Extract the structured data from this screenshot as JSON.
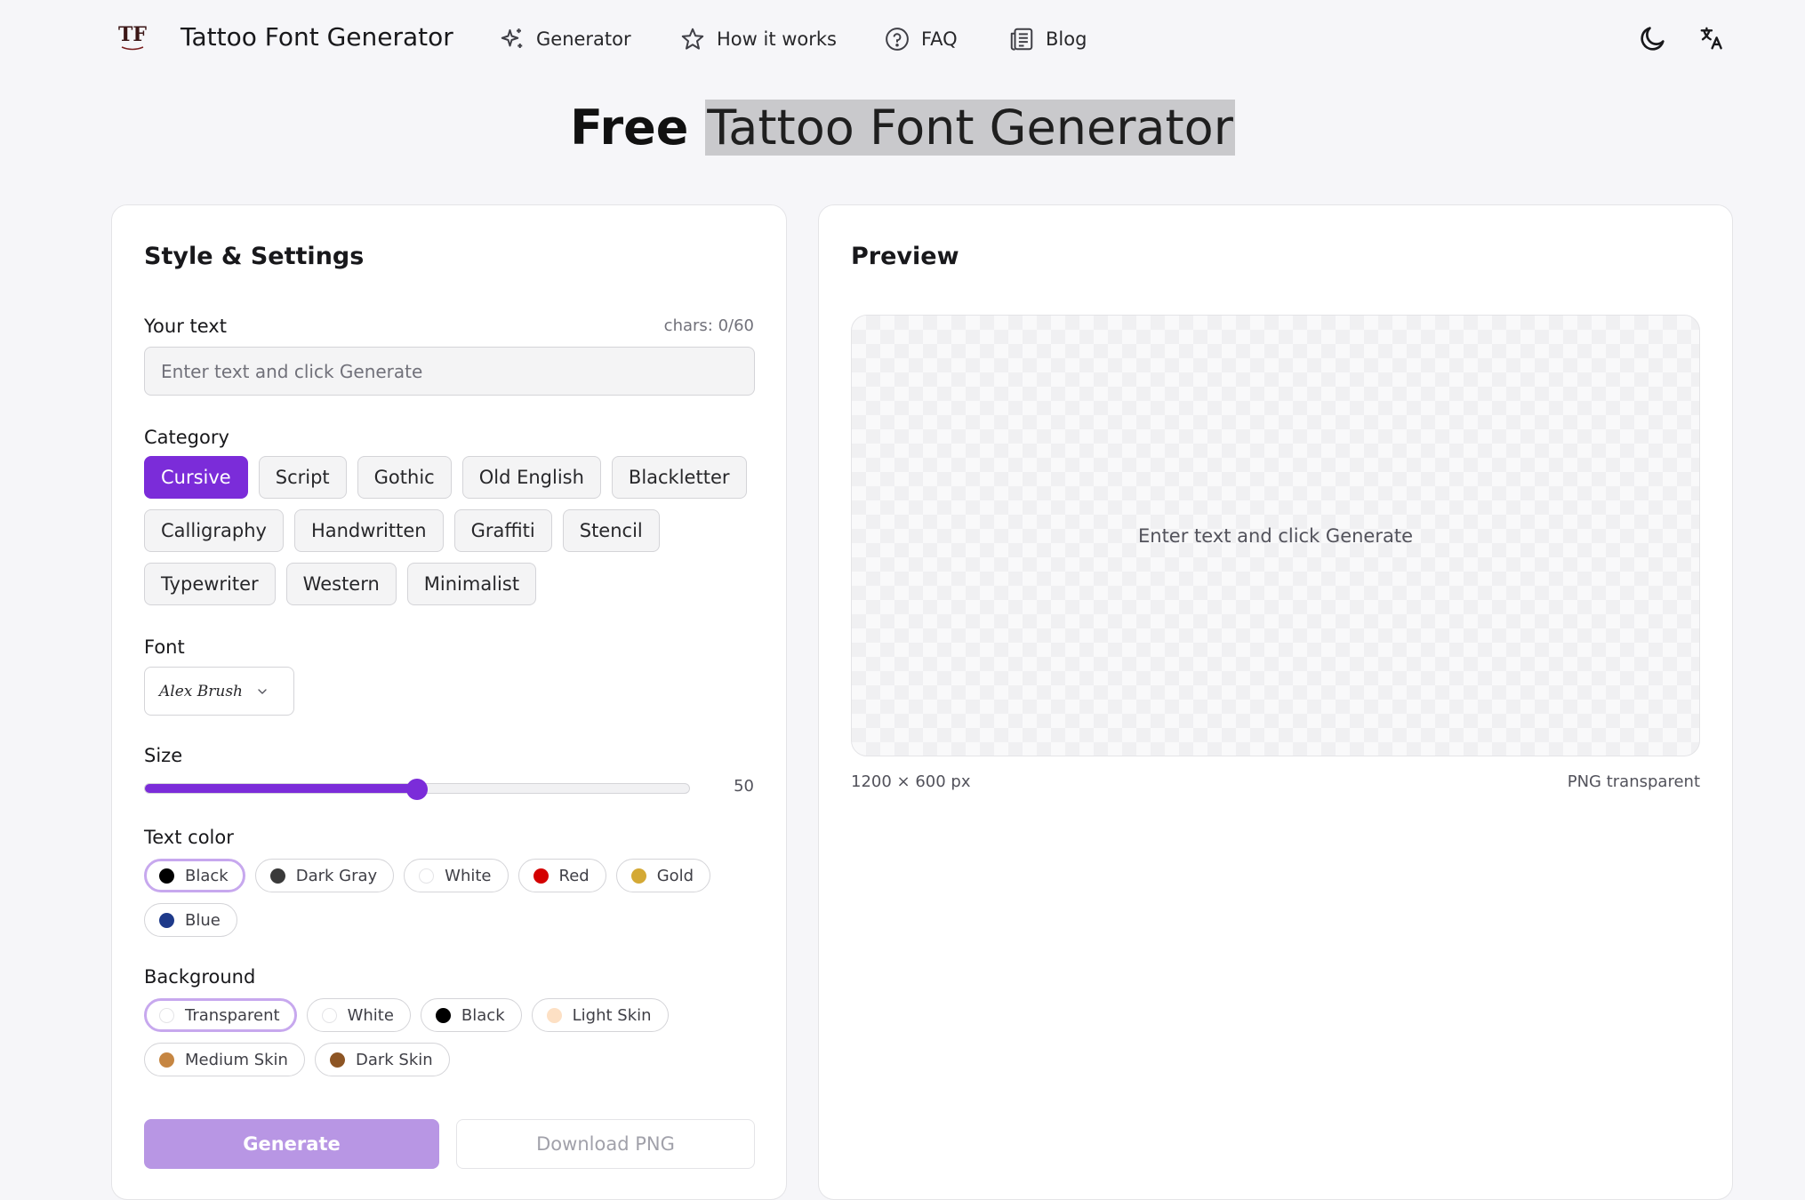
{
  "header": {
    "brand": "Tattoo Font Generator",
    "logo_text": "TF",
    "nav": [
      {
        "label": "Generator",
        "icon": "sparkles-icon"
      },
      {
        "label": "How it works",
        "icon": "star-outline-icon"
      },
      {
        "label": "FAQ",
        "icon": "help-circle-icon"
      },
      {
        "label": "Blog",
        "icon": "newspaper-icon"
      }
    ],
    "right_icons": [
      "moon-icon",
      "translate-icon"
    ]
  },
  "title": {
    "prefix": "Free",
    "highlight": "Tattoo Font Generator"
  },
  "settings": {
    "heading": "Style & Settings",
    "text_label": "Your text",
    "chars_counter": "chars: 0/60",
    "text_value": "",
    "text_placeholder": "Enter text and click Generate",
    "category_label": "Category",
    "categories": [
      "Cursive",
      "Script",
      "Gothic",
      "Old English",
      "Blackletter",
      "Calligraphy",
      "Handwritten",
      "Graffiti",
      "Stencil",
      "Typewriter",
      "Western",
      "Minimalist"
    ],
    "selected_category": "Cursive",
    "font_label": "Font",
    "font_value": "Alex Brush",
    "size_label": "Size",
    "size_value": "50",
    "size_fraction": 0.5,
    "text_color_label": "Text color",
    "text_colors": [
      {
        "label": "Black",
        "color": "#000000"
      },
      {
        "label": "Dark Gray",
        "color": "#3a3a3a"
      },
      {
        "label": "White",
        "color": "#ffffff"
      },
      {
        "label": "Red",
        "color": "#d40000"
      },
      {
        "label": "Gold",
        "color": "#d4a935"
      },
      {
        "label": "Blue",
        "color": "#1e3a8a"
      }
    ],
    "selected_text_color": "Black",
    "background_label": "Background",
    "backgrounds": [
      {
        "label": "Transparent",
        "color": "#ffffff"
      },
      {
        "label": "White",
        "color": "#ffffff"
      },
      {
        "label": "Black",
        "color": "#000000"
      },
      {
        "label": "Light Skin",
        "color": "#fde0c4"
      },
      {
        "label": "Medium Skin",
        "color": "#c68642"
      },
      {
        "label": "Dark Skin",
        "color": "#8d5524"
      }
    ],
    "selected_background": "Transparent",
    "generate_label": "Generate",
    "download_label": "Download PNG"
  },
  "preview": {
    "heading": "Preview",
    "message": "Enter text and click Generate",
    "dimensions": "1200 × 600 px",
    "format": "PNG transparent"
  },
  "colors": {
    "accent": "#7b2cd9",
    "accent_disabled": "#b896e4",
    "selected_ring": "#c7a8ee"
  }
}
